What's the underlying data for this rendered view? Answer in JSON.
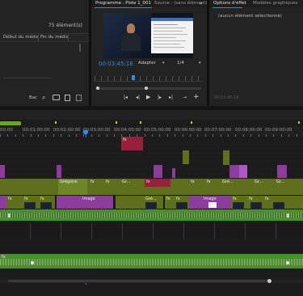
{
  "project_panel": {
    "item_count": "75 élément(s)",
    "col_media_start": "Début du média",
    "col_media_end": "Fin du média",
    "footer_label": "Bac"
  },
  "program_monitor": {
    "tab_program": "Programme : Piste 1_001",
    "tab_source": "Source : (sans élément)",
    "timecode": "00:03:45:16",
    "fit_select": "Adapter",
    "resolution_select": "1/4"
  },
  "effect_controls": {
    "tab_effect": "Options d'effet",
    "tab_graphics": "Modèles graphiques",
    "empty_message": "(aucun élément sélectionné)",
    "footer_timecode": "00:03:45:16"
  },
  "timeline": {
    "ruler": [
      "00:00",
      "00:01:00:00",
      "00:02:00:00",
      "00:03:00:00",
      "00:04:00:00",
      "00:05:00:00",
      "00:06:00:00",
      "00:07:00:00",
      "00:08:00:00",
      "00:09:00:00",
      "00:10:00:00"
    ],
    "clip_labels": {
      "fx": "fx",
      "gregoire": "Grégoire",
      "gr": "Gr...",
      "gre": "Gré...",
      "image": "Image"
    }
  },
  "colors": {
    "accent_blue": "#2d8ceb",
    "video_clip_purple": "#8c3c9c",
    "video_clip_olive": "#5e6f1d",
    "audio_clip_green": "#4f8a35",
    "clip_red": "#9a1f3a",
    "in_out_bar": "#6aa71b"
  }
}
